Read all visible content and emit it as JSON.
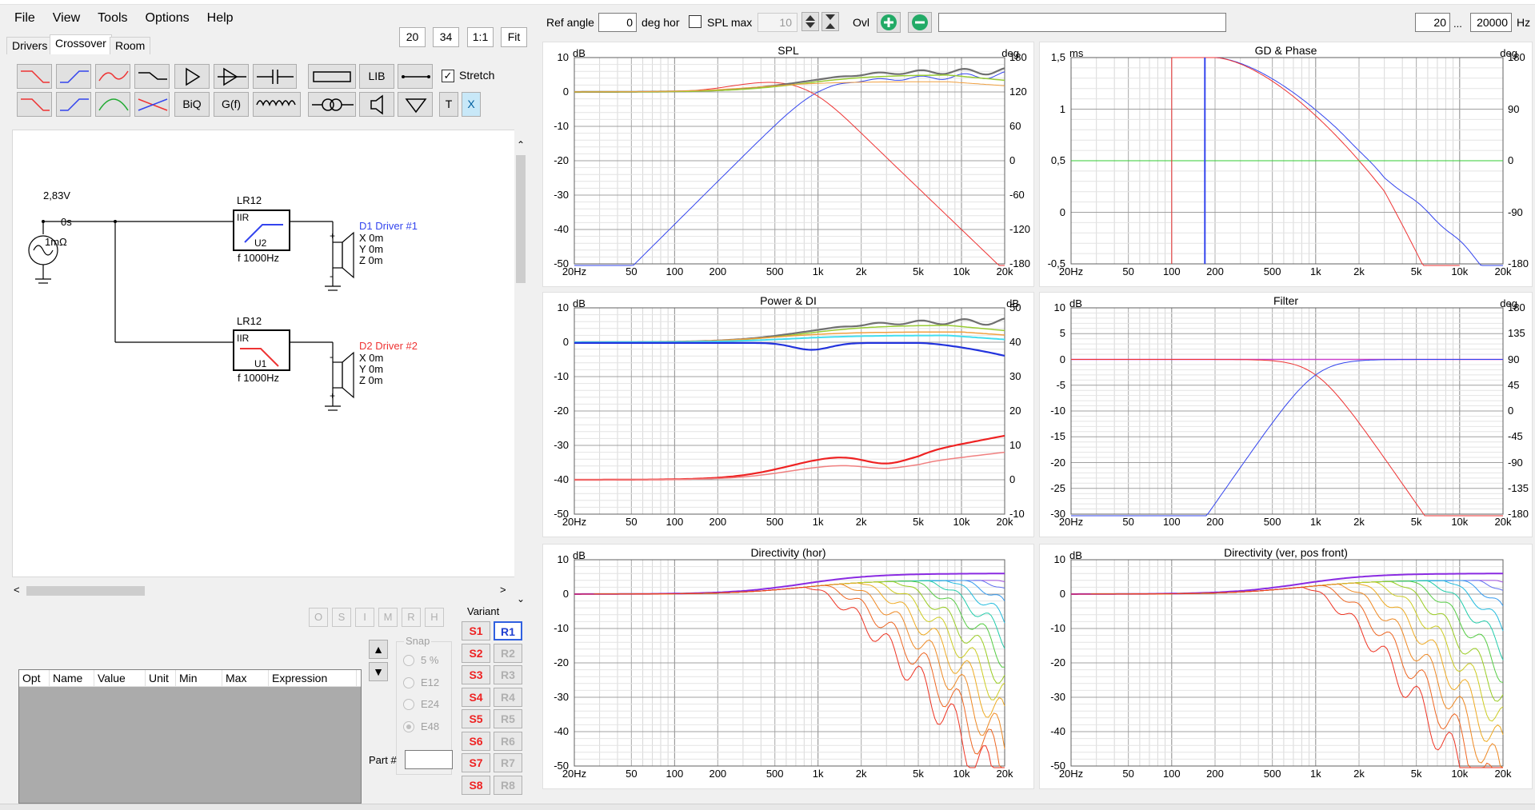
{
  "menu": [
    "File",
    "View",
    "Tools",
    "Options",
    "Help"
  ],
  "tabs": [
    "Drivers",
    "Crossover",
    "Room"
  ],
  "zoom": [
    "20",
    "34",
    "1:1",
    "Fit"
  ],
  "toolbar": {
    "lib": "LIB",
    "stretch": "Stretch",
    "biq": "BiQ",
    "gf": "G(f)",
    "t": "T",
    "x": "X"
  },
  "schematic": {
    "source": {
      "voltage": "2,83V",
      "delay": "0s",
      "resistance": "1mΩ"
    },
    "f1": {
      "type": "LR12",
      "kind": "IIR",
      "unit": "U2",
      "freq": "f  1000Hz"
    },
    "f2": {
      "type": "LR12",
      "kind": "IIR",
      "unit": "U1",
      "freq": "f  1000Hz"
    },
    "d1": {
      "name": "D1 Driver #1",
      "x": "X 0m",
      "y": "Y 0m",
      "z": "Z 0m"
    },
    "d2": {
      "name": "D2 Driver #2",
      "x": "X 0m",
      "y": "Y 0m",
      "z": "Z 0m"
    }
  },
  "solver_buttons": [
    "O",
    "S",
    "I",
    "M",
    "R",
    "H"
  ],
  "variant": {
    "label": "Variant",
    "s": [
      "S1",
      "S2",
      "S3",
      "S4",
      "S5",
      "S6",
      "S7",
      "S8"
    ],
    "r": [
      "R1",
      "R2",
      "R3",
      "R4",
      "R5",
      "R6",
      "R7",
      "R8"
    ]
  },
  "snap": {
    "label": "Snap",
    "options": [
      "5 %",
      "E12",
      "E24",
      "E48"
    ],
    "selected": "E48"
  },
  "part_label": "Part #",
  "opt_columns": [
    "Opt",
    "Name",
    "Value",
    "Unit",
    "Min",
    "Max",
    "Expression"
  ],
  "topbar": {
    "ref_label": "Ref angle",
    "ref_value": "0",
    "deg_hor": "deg hor",
    "splmax_label": "SPL max",
    "splmax_value": "10",
    "ovl": "Ovl",
    "fmin": "20",
    "dots": "...",
    "fmax": "20000",
    "hz": "Hz"
  },
  "colors": {
    "blue": "#3344ee",
    "red": "#ee3333",
    "gray": "#707070",
    "green": "#99cc33",
    "orange": "#f0a040",
    "cyan": "#44ddee"
  },
  "plots": [
    {
      "title": "SPL",
      "unitl": "dB",
      "unitr": "deg",
      "yl": [
        "10",
        "0",
        "-10",
        "-20",
        "-30",
        "-40",
        "-50"
      ],
      "yr": [
        "180",
        "120",
        "60",
        "0",
        "-60",
        "-120",
        "-180"
      ],
      "x": [
        "20Hz",
        "50",
        "100",
        "200",
        "500",
        "1k",
        "2k",
        "5k",
        "10k",
        "20k"
      ]
    },
    {
      "title": "GD & Phase",
      "unitl": "ms",
      "unitr": "deg",
      "yl": [
        "1,5",
        "1",
        "0,5",
        "0",
        "-0,5"
      ],
      "yr": [
        "180",
        "90",
        "0",
        "-90",
        "-180"
      ],
      "x": [
        "20Hz",
        "50",
        "100",
        "200",
        "500",
        "1k",
        "2k",
        "5k",
        "10k",
        "20k"
      ]
    },
    {
      "title": "Power & DI",
      "unitl": "dB",
      "unitr": "dB",
      "yl": [
        "10",
        "0",
        "-10",
        "-20",
        "-30",
        "-40",
        "-50"
      ],
      "yr": [
        "50",
        "40",
        "30",
        "20",
        "10",
        "0",
        "-10"
      ],
      "x": [
        "20Hz",
        "50",
        "100",
        "200",
        "500",
        "1k",
        "2k",
        "5k",
        "10k",
        "20k"
      ]
    },
    {
      "title": "Filter",
      "unitl": "dB",
      "unitr": "deg",
      "yl": [
        "10",
        "5",
        "0",
        "-5",
        "-10",
        "-15",
        "-20",
        "-25",
        "-30"
      ],
      "yr": [
        "180",
        "135",
        "90",
        "45",
        "0",
        "-45",
        "-90",
        "-135",
        "-180"
      ],
      "x": [
        "20Hz",
        "50",
        "100",
        "200",
        "500",
        "1k",
        "2k",
        "5k",
        "10k",
        "20k"
      ]
    },
    {
      "title": "Directivity (hor)",
      "unitl": "dB",
      "unitr": "",
      "yl": [
        "10",
        "0",
        "-10",
        "-20",
        "-30",
        "-40",
        "-50"
      ],
      "yr": [],
      "x": [
        "20Hz",
        "50",
        "100",
        "200",
        "500",
        "1k",
        "2k",
        "5k",
        "10k",
        "20k"
      ]
    },
    {
      "title": "Directivity (ver, pos front)",
      "unitl": "dB",
      "unitr": "",
      "yl": [
        "10",
        "0",
        "-10",
        "-20",
        "-30",
        "-40",
        "-50"
      ],
      "yr": [],
      "x": [
        "20Hz",
        "50",
        "100",
        "200",
        "500",
        "1k",
        "2k",
        "5k",
        "10k",
        "20k"
      ]
    }
  ]
}
